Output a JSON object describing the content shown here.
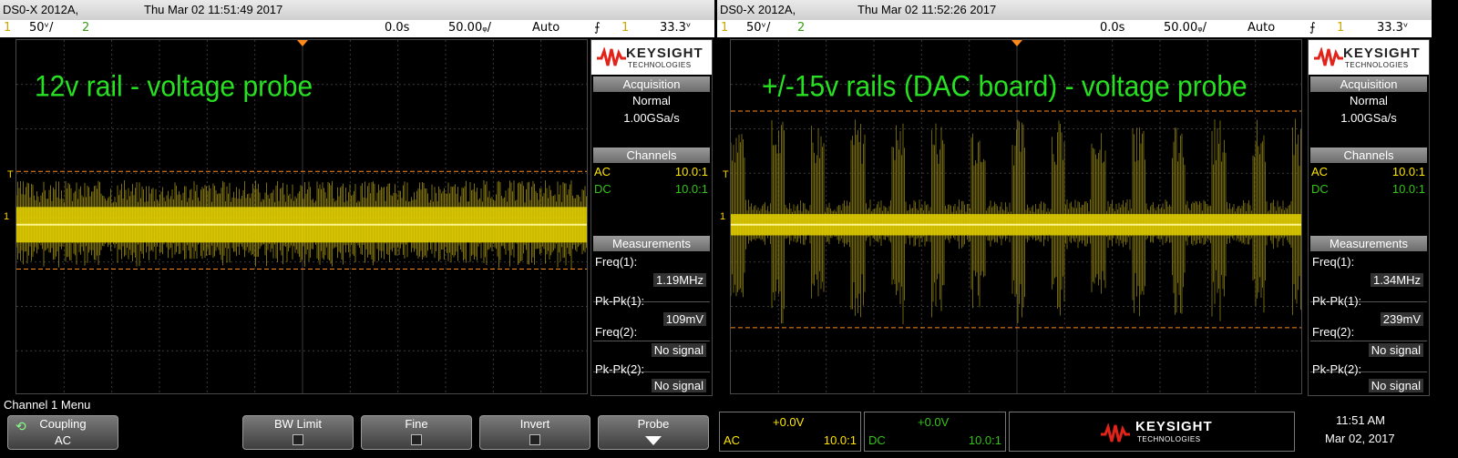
{
  "left": {
    "model": "DS0-X 2012A,",
    "datetime": "Thu Mar 02 11:51:49 2017",
    "status": {
      "ch1_num": "1",
      "ch1_scale": "50ᵛ/",
      "ch2_num": "2",
      "time_pos": "0.0s",
      "timebase": "50.00ᵩ/",
      "trigger_mode": "Auto",
      "trig_sym": "⨍",
      "trig_ch": "1",
      "trig_level": "33.3ᵛ"
    },
    "annotation": "12v rail - voltage probe",
    "trig_marker": "T",
    "ch1_marker": "1",
    "logo": {
      "name": "KEYSIGHT",
      "sub": "TECHNOLOGIES"
    },
    "acquisition": {
      "header": "Acquisition",
      "mode": "Normal",
      "rate": "1.00GSa/s"
    },
    "channels": {
      "header": "Channels",
      "rows": [
        {
          "coupling": "AC",
          "ratio": "10.0:1"
        },
        {
          "coupling": "DC",
          "ratio": "10.0:1"
        }
      ]
    },
    "measurements": {
      "header": "Measurements",
      "items": [
        {
          "label": "Freq(1):",
          "value": "1.19MHz"
        },
        {
          "label": "Pk-Pk(1):",
          "value": "109mV"
        },
        {
          "label": "Freq(2):",
          "value": "No signal"
        },
        {
          "label": "Pk-Pk(2):",
          "value": "No signal"
        }
      ]
    },
    "wave": {
      "centre_frac": 0.52,
      "env_frac": 0.1,
      "noise_frac": 0.25,
      "cursor_top_frac": 0.37,
      "cursor_bot_frac": 0.645
    }
  },
  "right": {
    "model": "DS0-X 2012A,",
    "datetime": "Thu Mar 02 11:52:26 2017",
    "status": {
      "ch1_num": "1",
      "ch1_scale": "50ᵛ/",
      "ch2_num": "2",
      "time_pos": "0.0s",
      "timebase": "50.00ᵩ/",
      "trigger_mode": "Auto",
      "trig_sym": "⨍",
      "trig_ch": "1",
      "trig_level": "33.3ᵛ"
    },
    "annotation": "+/-15v rails (DAC board) - voltage probe",
    "trig_marker": "T",
    "ch1_marker": "1",
    "logo": {
      "name": "KEYSIGHT",
      "sub": "TECHNOLOGIES"
    },
    "acquisition": {
      "header": "Acquisition",
      "mode": "Normal",
      "rate": "1.00GSa/s"
    },
    "channels": {
      "header": "Channels",
      "rows": [
        {
          "coupling": "AC",
          "ratio": "10.0:1"
        },
        {
          "coupling": "DC",
          "ratio": "10.0:1"
        }
      ]
    },
    "measurements": {
      "header": "Measurements",
      "items": [
        {
          "label": "Freq(1):",
          "value": "1.34MHz"
        },
        {
          "label": "Pk-Pk(1):",
          "value": "239mV"
        },
        {
          "label": "Freq(2):",
          "value": "No signal"
        },
        {
          "label": "Pk-Pk(2):",
          "value": "No signal"
        }
      ]
    },
    "wave": {
      "centre_frac": 0.52,
      "env_frac": 0.06,
      "noise_frac": 0.6,
      "cursor_top_frac": 0.2,
      "cursor_bot_frac": 0.81
    }
  },
  "bottom": {
    "menu_title": "Channel 1 Menu",
    "coupling": {
      "label": "Coupling",
      "value": "AC"
    },
    "bw_limit": "BW Limit",
    "fine": "Fine",
    "invert": "Invert",
    "probe": "Probe",
    "ch1": {
      "offset": "+0.0V",
      "coupling": "AC",
      "ratio": "10.0:1"
    },
    "ch2": {
      "offset": "+0.0V",
      "coupling": "DC",
      "ratio": "10.0:1"
    },
    "logo": {
      "name": "KEYSIGHT",
      "sub": "TECHNOLOGIES"
    },
    "time": "11:51 AM",
    "date": "Mar 02, 2017",
    "colors": {
      "ch1": "#ffe600",
      "ch2": "#35c21a",
      "annotation": "#27e022"
    }
  }
}
